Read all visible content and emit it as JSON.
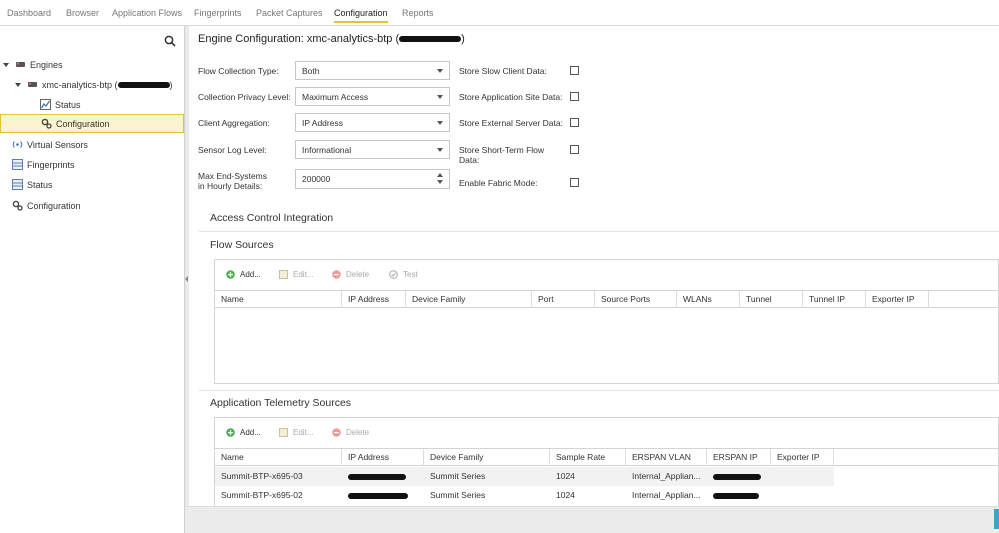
{
  "nav": {
    "tabs": [
      {
        "label": "Dashboard"
      },
      {
        "label": "Browser"
      },
      {
        "label": "Application Flows"
      },
      {
        "label": "Fingerprints"
      },
      {
        "label": "Packet Captures"
      },
      {
        "label": "Configuration",
        "active": true
      },
      {
        "label": "Reports"
      }
    ]
  },
  "sidebar": {
    "engines_label": "Engines",
    "engine_name": "xmc-analytics-btp (",
    "engine_name_suffix": ")",
    "status_label": "Status",
    "configuration_label": "Configuration",
    "virtual_sensors_label": "Virtual Sensors",
    "fingerprints_label": "Fingerprints",
    "root_status_label": "Status",
    "root_configuration_label": "Configuration"
  },
  "main": {
    "title": "Engine Configuration: xmc-analytics-btp (",
    "title_suffix": ")",
    "form": {
      "flow_collection_type": {
        "label": "Flow Collection Type:",
        "value": "Both"
      },
      "collection_privacy_level": {
        "label": "Collection Privacy Level:",
        "value": "Maximum Access"
      },
      "client_aggregation": {
        "label": "Client Aggregation:",
        "value": "IP Address"
      },
      "sensor_log_level": {
        "label": "Sensor Log Level:",
        "value": "Informational"
      },
      "max_end_systems": {
        "label_line1": "Max End-Systems",
        "label_line2": "in Hourly Details:",
        "value": "200000"
      },
      "store_slow_client": {
        "label": "Store Slow Client Data:"
      },
      "store_app_site": {
        "label": "Store Application Site Data:"
      },
      "store_external_server": {
        "label": "Store External Server Data:"
      },
      "store_short_term": {
        "label_line1": "Store Short-Term Flow",
        "label_line2": "Data:"
      },
      "enable_fabric": {
        "label": "Enable Fabric Mode:"
      }
    },
    "access_control_title": "Access Control Integration",
    "flow_sources": {
      "title": "Flow Sources",
      "toolbar": {
        "add": "Add...",
        "edit": "Edit...",
        "delete": "Delete",
        "test": "Test"
      },
      "columns": [
        "Name",
        "IP Address",
        "Device Family",
        "Port",
        "Source Ports",
        "WLANs",
        "Tunnel",
        "Tunnel IP",
        "Exporter IP"
      ]
    },
    "telemetry_sources": {
      "title": "Application Telemetry Sources",
      "toolbar": {
        "add": "Add...",
        "edit": "Edit...",
        "delete": "Delete"
      },
      "columns": [
        "Name",
        "IP Address",
        "Device Family",
        "Sample Rate",
        "ERSPAN VLAN",
        "ERSPAN IP",
        "Exporter IP"
      ],
      "rows": [
        {
          "name": "Summit-BTP-x695-03",
          "device_family": "Summit Series",
          "sample_rate": "1024",
          "erspan_vlan": "Internal_Applian..."
        },
        {
          "name": "Summit-BTP-x695-02",
          "device_family": "Summit Series",
          "sample_rate": "1024",
          "erspan_vlan": "Internal_Applian..."
        }
      ]
    }
  },
  "colors": {
    "accent": "#e6c22e",
    "selected_bg": "#fbf4cf",
    "add_green": "#4caf50",
    "delete_red": "#e57373"
  }
}
